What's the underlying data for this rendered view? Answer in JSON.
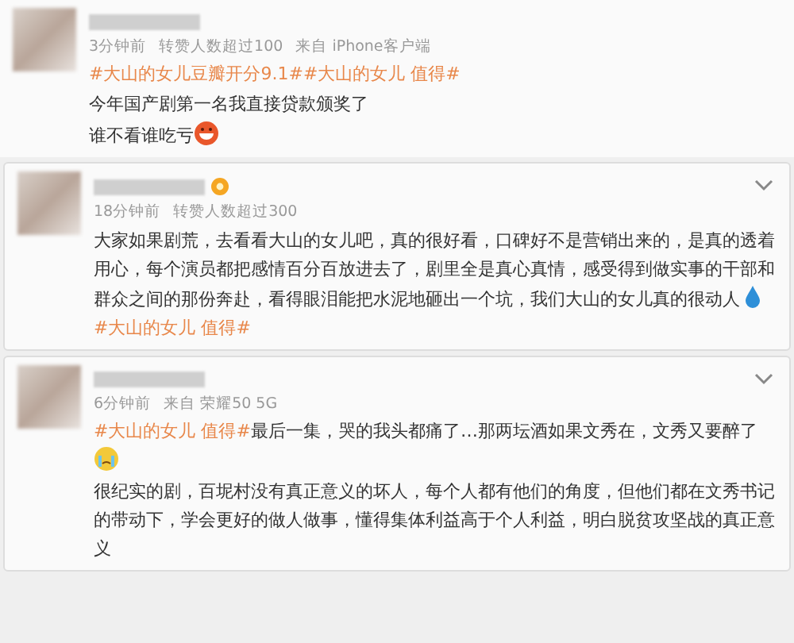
{
  "posts": [
    {
      "badge": false,
      "menu": false,
      "meta": [
        "3分钟前",
        "转赞人数超过100",
        "来自 iPhone客户端"
      ],
      "paragraphs": [
        [
          {
            "kind": "tag",
            "text": "#大山的女儿豆瓣开分9.1#"
          },
          {
            "kind": "tag",
            "text": "#大山的女儿 值得#"
          }
        ],
        [
          {
            "kind": "text",
            "text": "今年国产剧第一名我直接贷款颁奖了"
          }
        ],
        [
          {
            "kind": "text",
            "text": "谁不看谁吃亏"
          },
          {
            "kind": "grin"
          }
        ]
      ]
    },
    {
      "badge": true,
      "menu": true,
      "meta": [
        "18分钟前",
        "转赞人数超过300"
      ],
      "paragraphs": [
        [
          {
            "kind": "text",
            "text": "大家如果剧荒，去看看大山的女儿吧，真的很好看，口碑好不是营销出来的，是真的透着用心，每个演员都把感情百分百放进去了，剧里全是真心真情，感受得到做实事的干部和群众之间的那份奔赴，看得眼泪能把水泥地砸出一个坑，我们大山的女儿真的很动人"
          },
          {
            "kind": "drop"
          },
          {
            "kind": "tag",
            "text": "#大山的女儿 值得#"
          }
        ]
      ]
    },
    {
      "badge": false,
      "menu": true,
      "meta": [
        "6分钟前",
        "来自 荣耀50 5G"
      ],
      "paragraphs": [
        [
          {
            "kind": "tag",
            "text": "#大山的女儿 值得#"
          },
          {
            "kind": "text",
            "text": "最后一集，哭的我头都痛了…那两坛酒如果文秀在，文秀又要醉了"
          },
          {
            "kind": "break"
          },
          {
            "kind": "cry"
          }
        ],
        [
          {
            "kind": "text",
            "text": "很纪实的剧，百坭村没有真正意义的坏人，每个人都有他们的角度，但他们都在文秀书记的带动下，学会更好的做人做事，懂得集体利益高于个人利益，明白脱贫攻坚战的真正意义"
          }
        ]
      ]
    }
  ]
}
